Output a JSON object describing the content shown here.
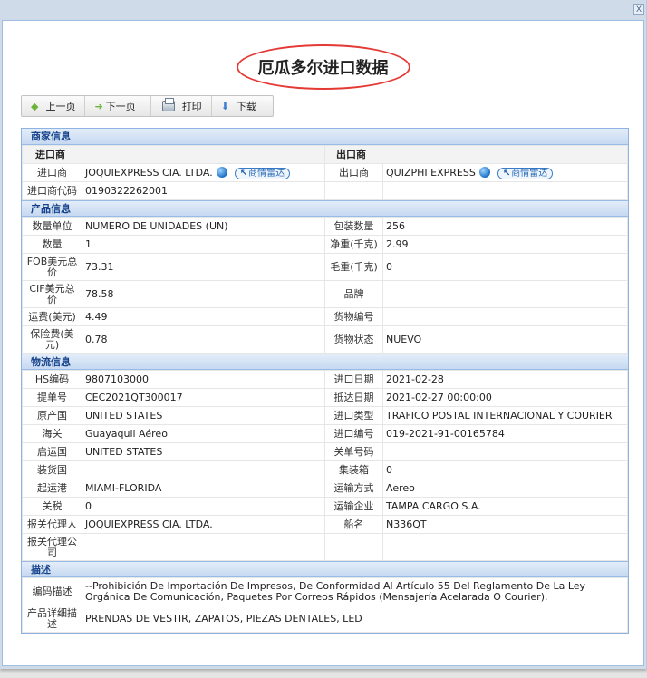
{
  "dialog": {
    "close_label": "X"
  },
  "title": "厄瓜多尔进口数据",
  "toolbar": {
    "prev": "上一页",
    "next": "下一页",
    "print": "打印",
    "download": "下载",
    "icons": {
      "prev": "arrow-left-icon",
      "next": "arrow-right-icon",
      "print": "printer-icon",
      "download": "arrow-down-icon"
    }
  },
  "merchant": {
    "section": "商家信息",
    "importer_head": "进口商",
    "exporter_head": "出口商",
    "importer_label": "进口商",
    "importer_value": "JOQUIEXPRESS CIA. LTDA.",
    "exporter_label": "出口商",
    "exporter_value": "QUIZPHI EXPRESS",
    "importer_code_label": "进口商代码",
    "importer_code_value": "0190322262001",
    "radar_label": "商情雷达"
  },
  "product": {
    "section": "产品信息",
    "rows": [
      {
        "l1": "数量单位",
        "v1": "NUMERO DE UNIDADES (UN)",
        "l2": "包装数量",
        "v2": "256"
      },
      {
        "l1": "数量",
        "v1": "1",
        "l2": "净重(千克)",
        "v2": "2.99"
      },
      {
        "l1": "FOB美元总价",
        "v1": "73.31",
        "l2": "毛重(千克)",
        "v2": "0"
      },
      {
        "l1": "CIF美元总价",
        "v1": "78.58",
        "l2": "品牌",
        "v2": ""
      },
      {
        "l1": "运费(美元)",
        "v1": "4.49",
        "l2": "货物编号",
        "v2": ""
      },
      {
        "l1": "保险费(美元)",
        "v1": "0.78",
        "l2": "货物状态",
        "v2": "NUEVO"
      }
    ]
  },
  "logistics": {
    "section": "物流信息",
    "rows": [
      {
        "l1": "HS编码",
        "v1": "9807103000",
        "l2": "进口日期",
        "v2": "2021-02-28"
      },
      {
        "l1": "提单号",
        "v1": "CEC2021QT300017",
        "l2": "抵达日期",
        "v2": "2021-02-27 00:00:00"
      },
      {
        "l1": "原产国",
        "v1": "UNITED STATES",
        "l2": "进口类型",
        "v2": "TRAFICO POSTAL INTERNACIONAL Y COURIER"
      },
      {
        "l1": "海关",
        "v1": "Guayaquil Aéreo",
        "l2": "进口编号",
        "v2": "019-2021-91-00165784"
      },
      {
        "l1": "启运国",
        "v1": "UNITED STATES",
        "l2": "关单号码",
        "v2": ""
      },
      {
        "l1": "装货国",
        "v1": "",
        "l2": "集装箱",
        "v2": "0"
      },
      {
        "l1": "起运港",
        "v1": "MIAMI-FLORIDA",
        "l2": "运输方式",
        "v2": "Aereo"
      },
      {
        "l1": "关税",
        "v1": "0",
        "l2": "运输企业",
        "v2": "TAMPA CARGO S.A."
      },
      {
        "l1": "报关代理人",
        "v1": "JOQUIEXPRESS CIA. LTDA.",
        "l2": "船名",
        "v2": "N336QT"
      },
      {
        "l1": "报关代理公司",
        "v1": "",
        "l2": "",
        "v2": ""
      }
    ]
  },
  "description": {
    "section": "描述",
    "code_desc_label": "编码描述",
    "code_desc_value": "--Prohibición De Importación De Impresos, De Conformidad Al Artículo 55 Del Reglamento De La Ley Orgánica De Comunicación, Paquetes Por Correos Rápidos (Mensajería Acelarada O Courier).",
    "product_desc_label": "产品详细描述",
    "product_desc_value": "PRENDAS DE VESTIR, ZAPATOS, PIEZAS DENTALES, LED"
  }
}
